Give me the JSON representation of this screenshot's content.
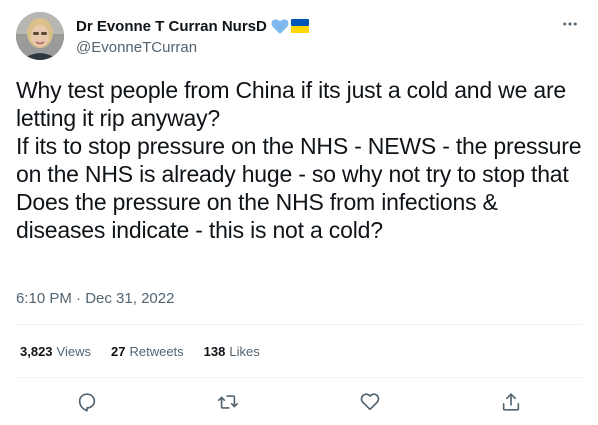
{
  "author": {
    "display_name": "Dr Evonne T Curran NursD",
    "handle": "@EvonneTCurran",
    "badge_icons": [
      "blue-heart-icon",
      "ukraine-flag-icon"
    ]
  },
  "tweet": {
    "lines": [
      "Why test people from China if its just a cold and we are letting it rip anyway?",
      "If its to stop pressure on the NHS - NEWS - the pressure on the NHS is already huge - so why not try to stop that",
      "Does the pressure on the NHS from infections & diseases indicate - this is not a cold?"
    ],
    "time": "6:10 PM",
    "separator": "·",
    "date": "Dec 31, 2022"
  },
  "stats": {
    "views": {
      "count": "3,823",
      "label": "Views"
    },
    "retweets": {
      "count": "27",
      "label": "Retweets"
    },
    "likes": {
      "count": "138",
      "label": "Likes"
    }
  },
  "actions": [
    "reply-icon",
    "retweet-icon",
    "like-icon",
    "share-icon"
  ],
  "colors": {
    "text": "#0f1419",
    "secondary": "#536471",
    "divider": "#eff3f4",
    "heart": "#7cb8ec",
    "flag_blue": "#0057b7",
    "flag_yellow": "#ffd700"
  }
}
